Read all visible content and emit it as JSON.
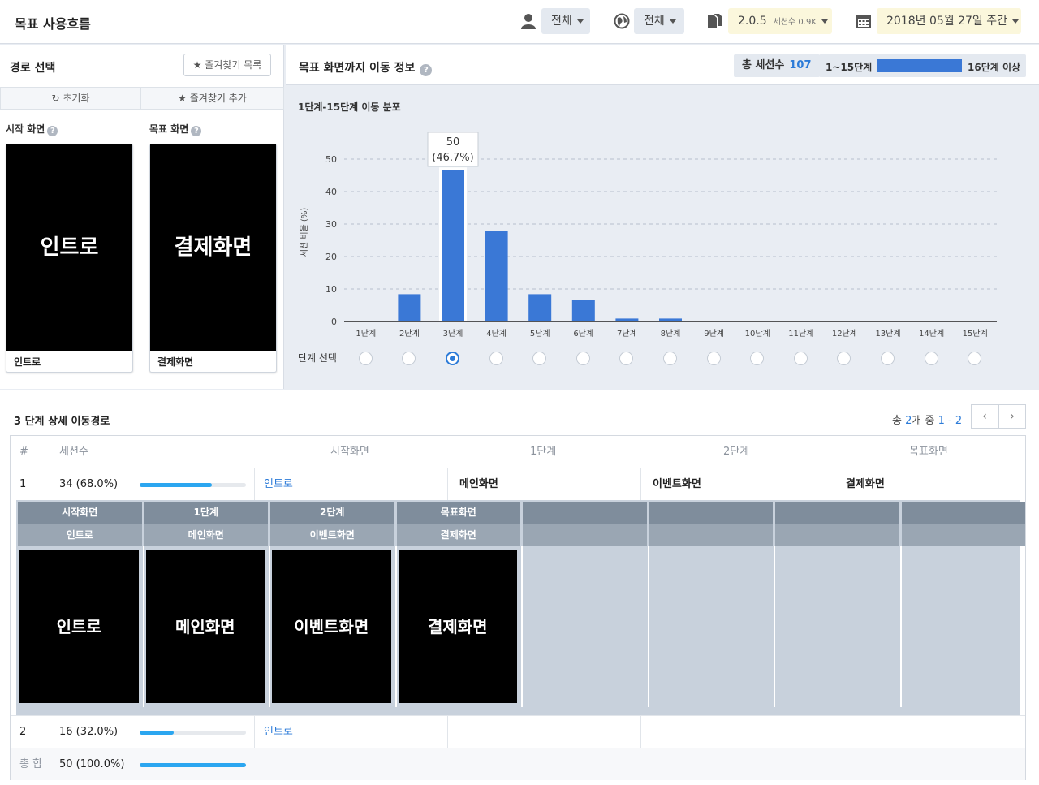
{
  "header": {
    "title": "목표 사용흐름",
    "user_filter": "전체",
    "region_filter": "전체",
    "version": "2.0.5",
    "version_sessions": "세션수 0.9K",
    "date": "2018년 05월 27일 주간"
  },
  "left": {
    "title": "경로 선택",
    "fav_list": "★ 즐겨찾기 목록",
    "reset": "초기화",
    "fav_add": "★ 즐겨찾기 추가",
    "start_label": "시작 화면",
    "goal_label": "목표 화면",
    "start_screen": "인트로",
    "start_caption": "인트로",
    "goal_screen": "결제화면",
    "goal_caption": "결제화면"
  },
  "right": {
    "title": "목표 화면까지 이동 정보",
    "total_sessions_label": "총 세션수",
    "total_sessions": "107",
    "legend_left": "1~15단계",
    "legend_right": "16단계 이상",
    "step_select_label": "단계 선택",
    "selected_step_index": 2
  },
  "chart_data": {
    "type": "bar",
    "title": "1단계-15단계 이동 분포",
    "ylabel": "세션 비율 (%)",
    "xlabel": "",
    "ylim": [
      0,
      50
    ],
    "yticks": [
      0,
      10,
      20,
      30,
      40,
      50
    ],
    "grid": true,
    "categories": [
      "1단계",
      "2단계",
      "3단계",
      "4단계",
      "5단계",
      "6단계",
      "7단계",
      "8단계",
      "9단계",
      "10단계",
      "11단계",
      "12단계",
      "13단계",
      "14단계",
      "15단계"
    ],
    "values": [
      0,
      8.4,
      46.7,
      28.0,
      8.4,
      6.5,
      0.9,
      0.9,
      0,
      0,
      0,
      0,
      0,
      0,
      0
    ],
    "color": "#3a78d6",
    "tooltip": {
      "index": 2,
      "value": "50",
      "percent": "(46.7%)"
    }
  },
  "detail": {
    "title": "3 단계 상세 이동경로",
    "pager_prefix": "총",
    "pager_count": "2",
    "pager_mid": "개 중",
    "pager_range": "1 - 2",
    "prev": "‹",
    "next": "›",
    "columns": [
      "#",
      "세션수",
      "시작화면",
      "1단계",
      "2단계",
      "목표화면"
    ],
    "rows": [
      {
        "num": "1",
        "sessions": "34 (68.0%)",
        "ratio": 0.68,
        "start": "인트로",
        "step1": "메인화면",
        "step2": "이벤트화면",
        "goal": "결제화면"
      },
      {
        "num": "2",
        "sessions": "16 (32.0%)",
        "ratio": 0.32,
        "start": "인트로",
        "step1": "",
        "step2": "",
        "goal": ""
      }
    ],
    "total_label": "총 합",
    "total_sessions": "50 (100.0%)",
    "total_ratio": 1.0,
    "expand": {
      "headers": [
        "시작화면",
        "1단계",
        "2단계",
        "목표화면"
      ],
      "screens": [
        "인트로",
        "메인화면",
        "이벤트화면",
        "결제화면"
      ]
    }
  }
}
